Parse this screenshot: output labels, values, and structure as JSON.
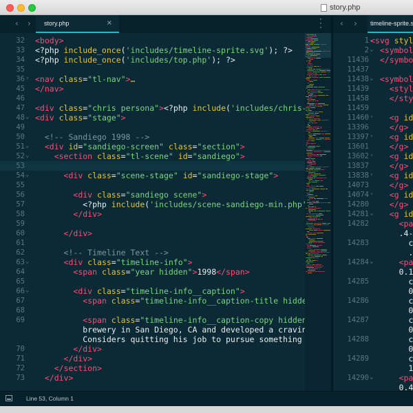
{
  "window": {
    "title": "story.php"
  },
  "tabs": {
    "left": {
      "label": "story.php",
      "close": "×"
    },
    "right": {
      "label": "timeline-sprite.svg"
    }
  },
  "nav": {
    "back": "‹",
    "forward": "›"
  },
  "status": {
    "cursor": "Line 53, Column 1"
  },
  "colors": {
    "background": "#0b2a35",
    "tag": "#ff4b76",
    "attribute": "#e6c52c",
    "string": "#7ad67f",
    "comment": "#7d969e",
    "accent": "#22b9c6"
  },
  "left_editor": {
    "lines": [
      {
        "n": "32",
        "fold": "",
        "tokens": [
          [
            "tag",
            "<body>"
          ]
        ]
      },
      {
        "n": "33",
        "fold": "",
        "tokens": [
          [
            "php",
            "<?php "
          ],
          [
            "fn",
            "include_once"
          ],
          [
            "php",
            "("
          ],
          [
            "str",
            "'includes/timeline-sprite.svg'"
          ],
          [
            "php",
            "); ?>"
          ]
        ]
      },
      {
        "n": "34",
        "fold": "",
        "tokens": [
          [
            "php",
            "<?php "
          ],
          [
            "fn",
            "include_once"
          ],
          [
            "php",
            "("
          ],
          [
            "str",
            "'includes/top.php'"
          ],
          [
            "php",
            "); ?>"
          ]
        ]
      },
      {
        "n": "35",
        "fold": "",
        "tokens": []
      },
      {
        "n": "36",
        "fold": "›",
        "tokens": [
          [
            "tag",
            "<nav "
          ],
          [
            "attr",
            "class"
          ],
          [
            "php",
            "="
          ],
          [
            "str",
            "\"tl-nav\""
          ],
          [
            "tag",
            ">"
          ],
          [
            "attr",
            "…"
          ]
        ]
      },
      {
        "n": "45",
        "fold": "",
        "tokens": [
          [
            "tag",
            "</nav>"
          ]
        ]
      },
      {
        "n": "46",
        "fold": "",
        "tokens": []
      },
      {
        "n": "47",
        "fold": "",
        "tokens": [
          [
            "tag",
            "<div "
          ],
          [
            "attr",
            "class"
          ],
          [
            "php",
            "="
          ],
          [
            "str",
            "\"chris persona\""
          ],
          [
            "tag",
            ">"
          ],
          [
            "php",
            "<?php "
          ],
          [
            "fn",
            "include"
          ],
          [
            "php",
            "("
          ],
          [
            "str",
            "'includes/chris-m"
          ]
        ]
      },
      {
        "n": "48",
        "fold": "⌄",
        "tokens": [
          [
            "tag",
            "<div "
          ],
          [
            "attr",
            "class"
          ],
          [
            "php",
            "="
          ],
          [
            "str",
            "\"stage\""
          ],
          [
            "tag",
            ">"
          ]
        ]
      },
      {
        "n": "49",
        "fold": "",
        "tokens": []
      },
      {
        "n": "50",
        "fold": "",
        "tokens": [
          [
            "cmt",
            "  <!-- Sandiego 1998 -->"
          ]
        ]
      },
      {
        "n": "51",
        "fold": "⌄",
        "tokens": [
          [
            "php",
            "  "
          ],
          [
            "tag",
            "<div "
          ],
          [
            "attr",
            "id"
          ],
          [
            "php",
            "="
          ],
          [
            "str",
            "\"sandiego-screen\""
          ],
          [
            "php",
            " "
          ],
          [
            "attr",
            "class"
          ],
          [
            "php",
            "="
          ],
          [
            "str",
            "\"section\""
          ],
          [
            "tag",
            ">"
          ]
        ]
      },
      {
        "n": "52",
        "fold": "⌄",
        "tokens": [
          [
            "php",
            "    "
          ],
          [
            "tag",
            "<section "
          ],
          [
            "attr",
            "class"
          ],
          [
            "php",
            "="
          ],
          [
            "str",
            "\"tl-scene\""
          ],
          [
            "php",
            " "
          ],
          [
            "attr",
            "id"
          ],
          [
            "php",
            "="
          ],
          [
            "str",
            "\"sandiego\""
          ],
          [
            "tag",
            ">"
          ]
        ]
      },
      {
        "n": "53",
        "fold": "",
        "tokens": []
      },
      {
        "n": "54",
        "fold": "⌄",
        "tokens": [
          [
            "php",
            "      "
          ],
          [
            "tag",
            "<div "
          ],
          [
            "attr",
            "class"
          ],
          [
            "php",
            "="
          ],
          [
            "str",
            "\"scene-stage\""
          ],
          [
            "php",
            " "
          ],
          [
            "attr",
            "id"
          ],
          [
            "php",
            "="
          ],
          [
            "str",
            "\"sandiego-stage\""
          ],
          [
            "tag",
            ">"
          ]
        ]
      },
      {
        "n": "55",
        "fold": "",
        "tokens": []
      },
      {
        "n": "56",
        "fold": "",
        "tokens": [
          [
            "php",
            "        "
          ],
          [
            "tag",
            "<div "
          ],
          [
            "attr",
            "class"
          ],
          [
            "php",
            "="
          ],
          [
            "str",
            "\"sandiego scene\""
          ],
          [
            "tag",
            ">"
          ]
        ]
      },
      {
        "n": "57",
        "fold": "",
        "tokens": [
          [
            "php",
            "          <?php "
          ],
          [
            "fn",
            "include"
          ],
          [
            "php",
            "("
          ],
          [
            "str",
            "'includes/scene-sandiego-min.php'"
          ],
          [
            "php",
            ");"
          ]
        ]
      },
      {
        "n": "58",
        "fold": "",
        "tokens": [
          [
            "php",
            "        "
          ],
          [
            "tag",
            "</div>"
          ]
        ]
      },
      {
        "n": "59",
        "fold": "",
        "tokens": []
      },
      {
        "n": "60",
        "fold": "",
        "tokens": [
          [
            "php",
            "      "
          ],
          [
            "tag",
            "</div>"
          ]
        ]
      },
      {
        "n": "61",
        "fold": "",
        "tokens": []
      },
      {
        "n": "62",
        "fold": "",
        "tokens": [
          [
            "cmt",
            "      <!-- Timeline Text -->"
          ]
        ]
      },
      {
        "n": "63",
        "fold": "⌄",
        "tokens": [
          [
            "php",
            "      "
          ],
          [
            "tag",
            "<div "
          ],
          [
            "attr",
            "class"
          ],
          [
            "php",
            "="
          ],
          [
            "str",
            "\"timeline-info\""
          ],
          [
            "tag",
            ">"
          ]
        ]
      },
      {
        "n": "64",
        "fold": "",
        "tokens": [
          [
            "php",
            "        "
          ],
          [
            "tag",
            "<span "
          ],
          [
            "attr",
            "class"
          ],
          [
            "php",
            "="
          ],
          [
            "str",
            "\"year hidden\""
          ],
          [
            "tag",
            ">"
          ],
          [
            "txt",
            "1998"
          ],
          [
            "tag",
            "</span>"
          ]
        ]
      },
      {
        "n": "65",
        "fold": "",
        "tokens": []
      },
      {
        "n": "66",
        "fold": "⌄",
        "tokens": [
          [
            "php",
            "        "
          ],
          [
            "tag",
            "<div "
          ],
          [
            "attr",
            "class"
          ],
          [
            "php",
            "="
          ],
          [
            "str",
            "\"timeline-info__caption\""
          ],
          [
            "tag",
            ">"
          ]
        ]
      },
      {
        "n": "67",
        "fold": "",
        "tokens": [
          [
            "php",
            "          "
          ],
          [
            "tag",
            "<span "
          ],
          [
            "attr",
            "class"
          ],
          [
            "php",
            "="
          ],
          [
            "str",
            "\"timeline-info__caption-title hidden'"
          ]
        ]
      },
      {
        "n": "68",
        "fold": "",
        "tokens": []
      },
      {
        "n": "69",
        "fold": "",
        "tokens": [
          [
            "php",
            "          "
          ],
          [
            "tag",
            "<span "
          ],
          [
            "attr",
            "class"
          ],
          [
            "php",
            "="
          ],
          [
            "str",
            "\"timeline-info__caption-copy hidden\""
          ],
          [
            "tag",
            ">"
          ]
        ]
      },
      {
        "n": "",
        "fold": "",
        "tokens": [
          [
            "txt",
            "          brewery in San Diego, CA and developed a craving"
          ]
        ]
      },
      {
        "n": "",
        "fold": "",
        "tokens": [
          [
            "txt",
            "          Considers quitting his job to pursue something mo"
          ]
        ]
      },
      {
        "n": "70",
        "fold": "",
        "tokens": [
          [
            "php",
            "        "
          ],
          [
            "tag",
            "</div>"
          ]
        ]
      },
      {
        "n": "71",
        "fold": "",
        "tokens": [
          [
            "php",
            "      "
          ],
          [
            "tag",
            "</div>"
          ]
        ]
      },
      {
        "n": "72",
        "fold": "",
        "tokens": [
          [
            "php",
            "    "
          ],
          [
            "tag",
            "</section>"
          ]
        ]
      },
      {
        "n": "73",
        "fold": "",
        "tokens": [
          [
            "php",
            "  "
          ],
          [
            "tag",
            "</div>"
          ]
        ]
      }
    ]
  },
  "right_editor": {
    "lines": [
      {
        "n": "1",
        "fold": "⌄",
        "tokens": [
          [
            "tag",
            "<svg "
          ],
          [
            "attr",
            "style"
          ]
        ]
      },
      {
        "n": "2",
        "fold": "⌄",
        "tokens": [
          [
            "php",
            "  "
          ],
          [
            "tag",
            "<symbol"
          ]
        ]
      },
      {
        "n": "11436",
        "fold": "",
        "tokens": [
          [
            "php",
            "  "
          ],
          [
            "tag",
            "</symbo"
          ]
        ]
      },
      {
        "n": "11437",
        "fold": "",
        "tokens": []
      },
      {
        "n": "11438",
        "fold": "⌄",
        "tokens": [
          [
            "php",
            "  "
          ],
          [
            "tag",
            "<symbol"
          ]
        ]
      },
      {
        "n": "11439",
        "fold": "",
        "tokens": [
          [
            "php",
            "    "
          ],
          [
            "tag",
            "<styl"
          ]
        ]
      },
      {
        "n": "11458",
        "fold": "",
        "tokens": [
          [
            "php",
            "    "
          ],
          [
            "tag",
            "</sty"
          ]
        ]
      },
      {
        "n": "11459",
        "fold": "",
        "tokens": []
      },
      {
        "n": "11460",
        "fold": "›",
        "tokens": [
          [
            "php",
            "    "
          ],
          [
            "tag",
            "<g "
          ],
          [
            "attr",
            "id="
          ]
        ]
      },
      {
        "n": "13396",
        "fold": "",
        "tokens": [
          [
            "php",
            "    "
          ],
          [
            "tag",
            "</g>"
          ]
        ]
      },
      {
        "n": "13397",
        "fold": "›",
        "tokens": [
          [
            "php",
            "    "
          ],
          [
            "tag",
            "<g "
          ],
          [
            "attr",
            "id="
          ]
        ]
      },
      {
        "n": "13601",
        "fold": "",
        "tokens": [
          [
            "php",
            "    "
          ],
          [
            "tag",
            "</g>"
          ]
        ]
      },
      {
        "n": "13602",
        "fold": "›",
        "tokens": [
          [
            "php",
            "    "
          ],
          [
            "tag",
            "<g "
          ],
          [
            "attr",
            "id="
          ]
        ]
      },
      {
        "n": "13837",
        "fold": "",
        "tokens": [
          [
            "php",
            "    "
          ],
          [
            "tag",
            "</g>"
          ]
        ]
      },
      {
        "n": "13838",
        "fold": "›",
        "tokens": [
          [
            "php",
            "    "
          ],
          [
            "tag",
            "<g "
          ],
          [
            "attr",
            "id="
          ]
        ]
      },
      {
        "n": "14073",
        "fold": "",
        "tokens": [
          [
            "php",
            "    "
          ],
          [
            "tag",
            "</g>"
          ]
        ]
      },
      {
        "n": "14074",
        "fold": "›",
        "tokens": [
          [
            "php",
            "    "
          ],
          [
            "tag",
            "<g "
          ],
          [
            "attr",
            "id="
          ]
        ]
      },
      {
        "n": "14280",
        "fold": "",
        "tokens": [
          [
            "php",
            "    "
          ],
          [
            "tag",
            "</g>"
          ]
        ]
      },
      {
        "n": "14281",
        "fold": "⌄",
        "tokens": [
          [
            "php",
            "    "
          ],
          [
            "tag",
            "<g "
          ],
          [
            "attr",
            "id="
          ]
        ]
      },
      {
        "n": "14282",
        "fold": "",
        "tokens": [
          [
            "php",
            "      "
          ],
          [
            "tag",
            "<pat"
          ]
        ]
      },
      {
        "n": "",
        "fold": "",
        "tokens": [
          [
            "txt",
            "      .4-"
          ]
        ]
      },
      {
        "n": "14283",
        "fold": "",
        "tokens": [
          [
            "txt",
            "        c"
          ]
        ]
      },
      {
        "n": "",
        "fold": "",
        "tokens": [
          [
            "txt",
            "        ."
          ]
        ]
      },
      {
        "n": "14284",
        "fold": "⌄",
        "tokens": [
          [
            "php",
            "      "
          ],
          [
            "tag",
            "<pat"
          ]
        ]
      },
      {
        "n": "",
        "fold": "",
        "tokens": [
          [
            "txt",
            "      0.1"
          ]
        ]
      },
      {
        "n": "14285",
        "fold": "",
        "tokens": [
          [
            "txt",
            "        c"
          ]
        ]
      },
      {
        "n": "",
        "fold": "",
        "tokens": [
          [
            "txt",
            "        0"
          ]
        ]
      },
      {
        "n": "14286",
        "fold": "",
        "tokens": [
          [
            "txt",
            "        c"
          ]
        ]
      },
      {
        "n": "",
        "fold": "",
        "tokens": [
          [
            "txt",
            "        0"
          ]
        ]
      },
      {
        "n": "14287",
        "fold": "",
        "tokens": [
          [
            "txt",
            "        c"
          ]
        ]
      },
      {
        "n": "",
        "fold": "",
        "tokens": [
          [
            "txt",
            "        0"
          ]
        ]
      },
      {
        "n": "14288",
        "fold": "",
        "tokens": [
          [
            "txt",
            "        c"
          ]
        ]
      },
      {
        "n": "",
        "fold": "",
        "tokens": [
          [
            "txt",
            "        0"
          ]
        ]
      },
      {
        "n": "14289",
        "fold": "",
        "tokens": [
          [
            "txt",
            "        c"
          ]
        ]
      },
      {
        "n": "",
        "fold": "",
        "tokens": [
          [
            "txt",
            "        1"
          ]
        ]
      },
      {
        "n": "14290",
        "fold": "⌄",
        "tokens": [
          [
            "php",
            "      "
          ],
          [
            "tag",
            "<pat"
          ]
        ]
      },
      {
        "n": "",
        "fold": "",
        "tokens": [
          [
            "txt",
            "      0.4"
          ]
        ]
      }
    ]
  }
}
